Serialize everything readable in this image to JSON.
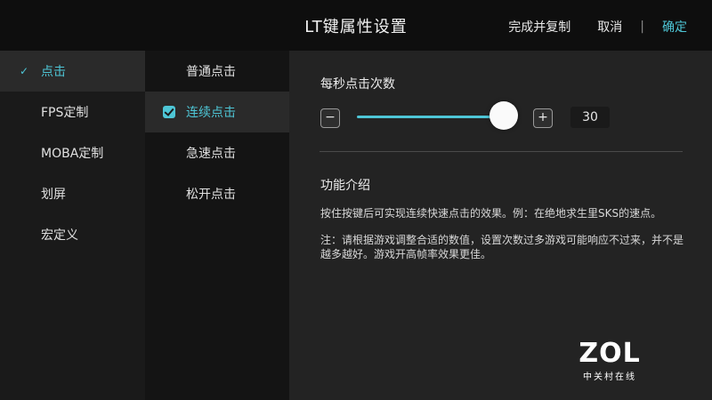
{
  "header": {
    "title": "LT键属性设置",
    "complete_copy": "完成并复制",
    "cancel": "取消",
    "separator": "|",
    "confirm": "确定"
  },
  "nav": {
    "items": [
      {
        "label": "点击",
        "active": true,
        "check": "✓"
      },
      {
        "label": "FPS定制"
      },
      {
        "label": "MOBA定制"
      },
      {
        "label": "划屏"
      },
      {
        "label": "宏定义"
      }
    ]
  },
  "sub": {
    "items": [
      {
        "label": "普通点击"
      },
      {
        "label": "连续点击",
        "active": true
      },
      {
        "label": "急速点击"
      },
      {
        "label": "松开点击"
      }
    ]
  },
  "settings": {
    "clicks_per_second_label": "每秒点击次数",
    "minus": "−",
    "plus": "+",
    "value": "30",
    "slider_fraction": 1.0
  },
  "intro": {
    "title": "功能介绍",
    "line1": "按住按键后可实现连续快速点击的效果。例：在绝地求生里SKS的速点。",
    "line2": "注：请根据游戏调整合适的数值，设置次数过多游戏可能响应不过来，并不是越多越好。游戏开高帧率效果更佳。"
  },
  "watermark": {
    "brand": "ZOL",
    "sub": "中关村在线"
  },
  "colors": {
    "accent": "#4ec6d6",
    "background": "#121212"
  }
}
